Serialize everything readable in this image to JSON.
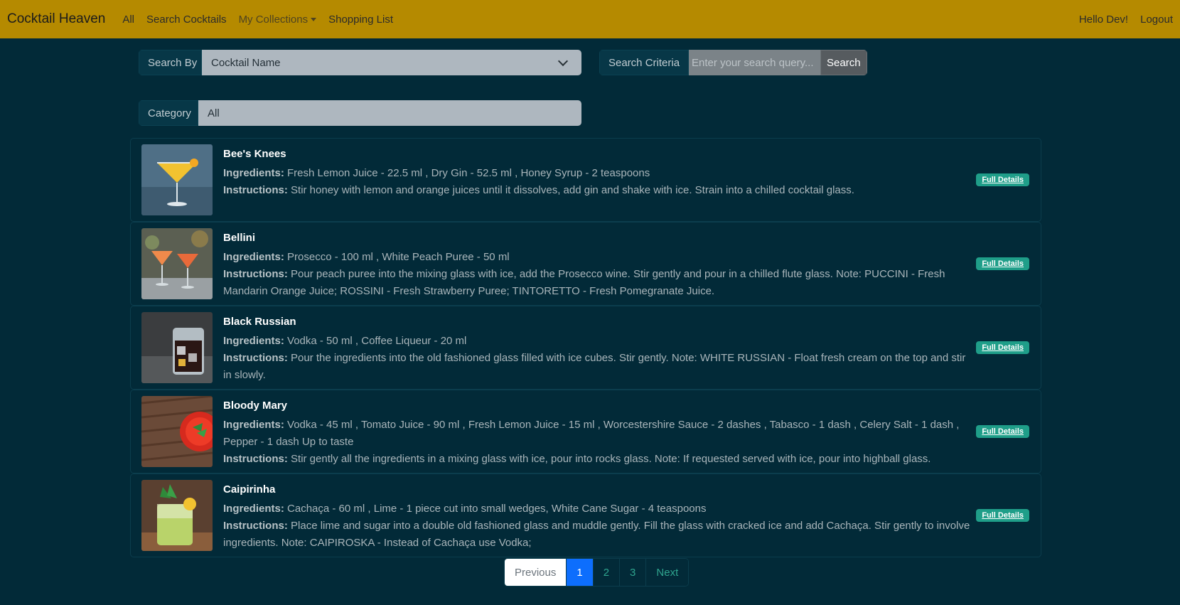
{
  "navbar": {
    "brand": "Cocktail Heaven",
    "links": [
      "All",
      "Search Cocktails",
      "My Collections",
      "Shopping List"
    ],
    "greeting": "Hello Dev!",
    "logout": "Logout"
  },
  "search": {
    "search_by_label": "Search By",
    "search_by_value": "Cocktail Name",
    "criteria_label": "Search Criteria",
    "criteria_placeholder": "Enter your search query...",
    "search_button": "Search",
    "category_label": "Category",
    "category_value": "All"
  },
  "labels": {
    "ingredients": "Ingredients:",
    "instructions": "Instructions:",
    "details": "Full Details"
  },
  "cocktails": [
    {
      "name": "Bee's Knees",
      "ingredients": "Fresh Lemon Juice - 22.5 ml , Dry Gin - 52.5 ml , Honey Syrup - 2 teaspoons",
      "instructions": "Stir honey with lemon and orange juices until it dissolves, add gin and shake with ice. Strain into a chilled cocktail glass."
    },
    {
      "name": "Bellini",
      "ingredients": "Prosecco - 100 ml , White Peach Puree - 50 ml",
      "instructions": "Pour peach puree into the mixing glass with ice, add the Prosecco wine. Stir gently and pour in a chilled flute glass. Note: PUCCINI - Fresh Mandarin Orange Juice; ROSSINI - Fresh Strawberry Puree; TINTORETTO - Fresh Pomegranate Juice."
    },
    {
      "name": "Black Russian",
      "ingredients": "Vodka - 50 ml , Coffee Liqueur - 20 ml",
      "instructions": "Pour the ingredients into the old fashioned glass filled with ice cubes. Stir gently. Note: WHITE RUSSIAN - Float fresh cream on the top and stir in slowly."
    },
    {
      "name": "Bloody Mary",
      "ingredients": "Vodka - 45 ml , Tomato Juice - 90 ml , Fresh Lemon Juice - 15 ml , Worcestershire Sauce - 2 dashes , Tabasco - 1 dash , Celery Salt - 1 dash , Pepper - 1 dash Up to taste",
      "instructions": "Stir gently all the ingredients in a mixing glass with ice, pour into rocks glass. Note: If requested served with ice, pour into highball glass."
    },
    {
      "name": "Caipirinha",
      "ingredients": "Cachaça - 60 ml , Lime - 1 piece cut into small wedges, White Cane Sugar - 4 teaspoons",
      "instructions": "Place lime and sugar into a double old fashioned glass and muddle gently. Fill the glass with cracked ice and add Cachaça. Stir gently to involve ingredients. Note: CAIPIROSKA - Instead of Cachaça use Vodka;"
    }
  ],
  "pagination": {
    "previous": "Previous",
    "pages": [
      "1",
      "2",
      "3"
    ],
    "next": "Next"
  }
}
